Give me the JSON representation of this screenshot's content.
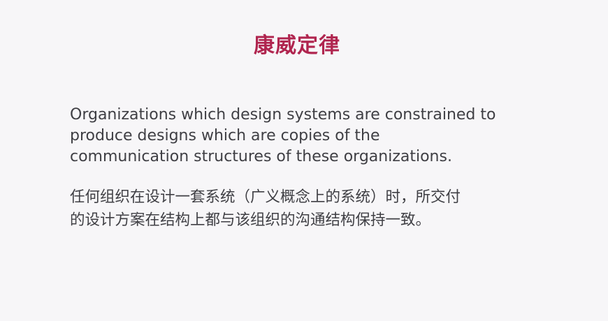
{
  "slide": {
    "title": "康威定律",
    "title_color": "#b0254f",
    "english_lines": [
      "Organizations which design systems are constrained to",
      "produce designs which are copies of the",
      "communication structures of these organizations."
    ],
    "chinese_lines": [
      "任何组织在设计一套系统（广义概念上的系统）时，所交付",
      "的设计方案在结构上都与该组织的沟通结构保持一致。"
    ]
  }
}
